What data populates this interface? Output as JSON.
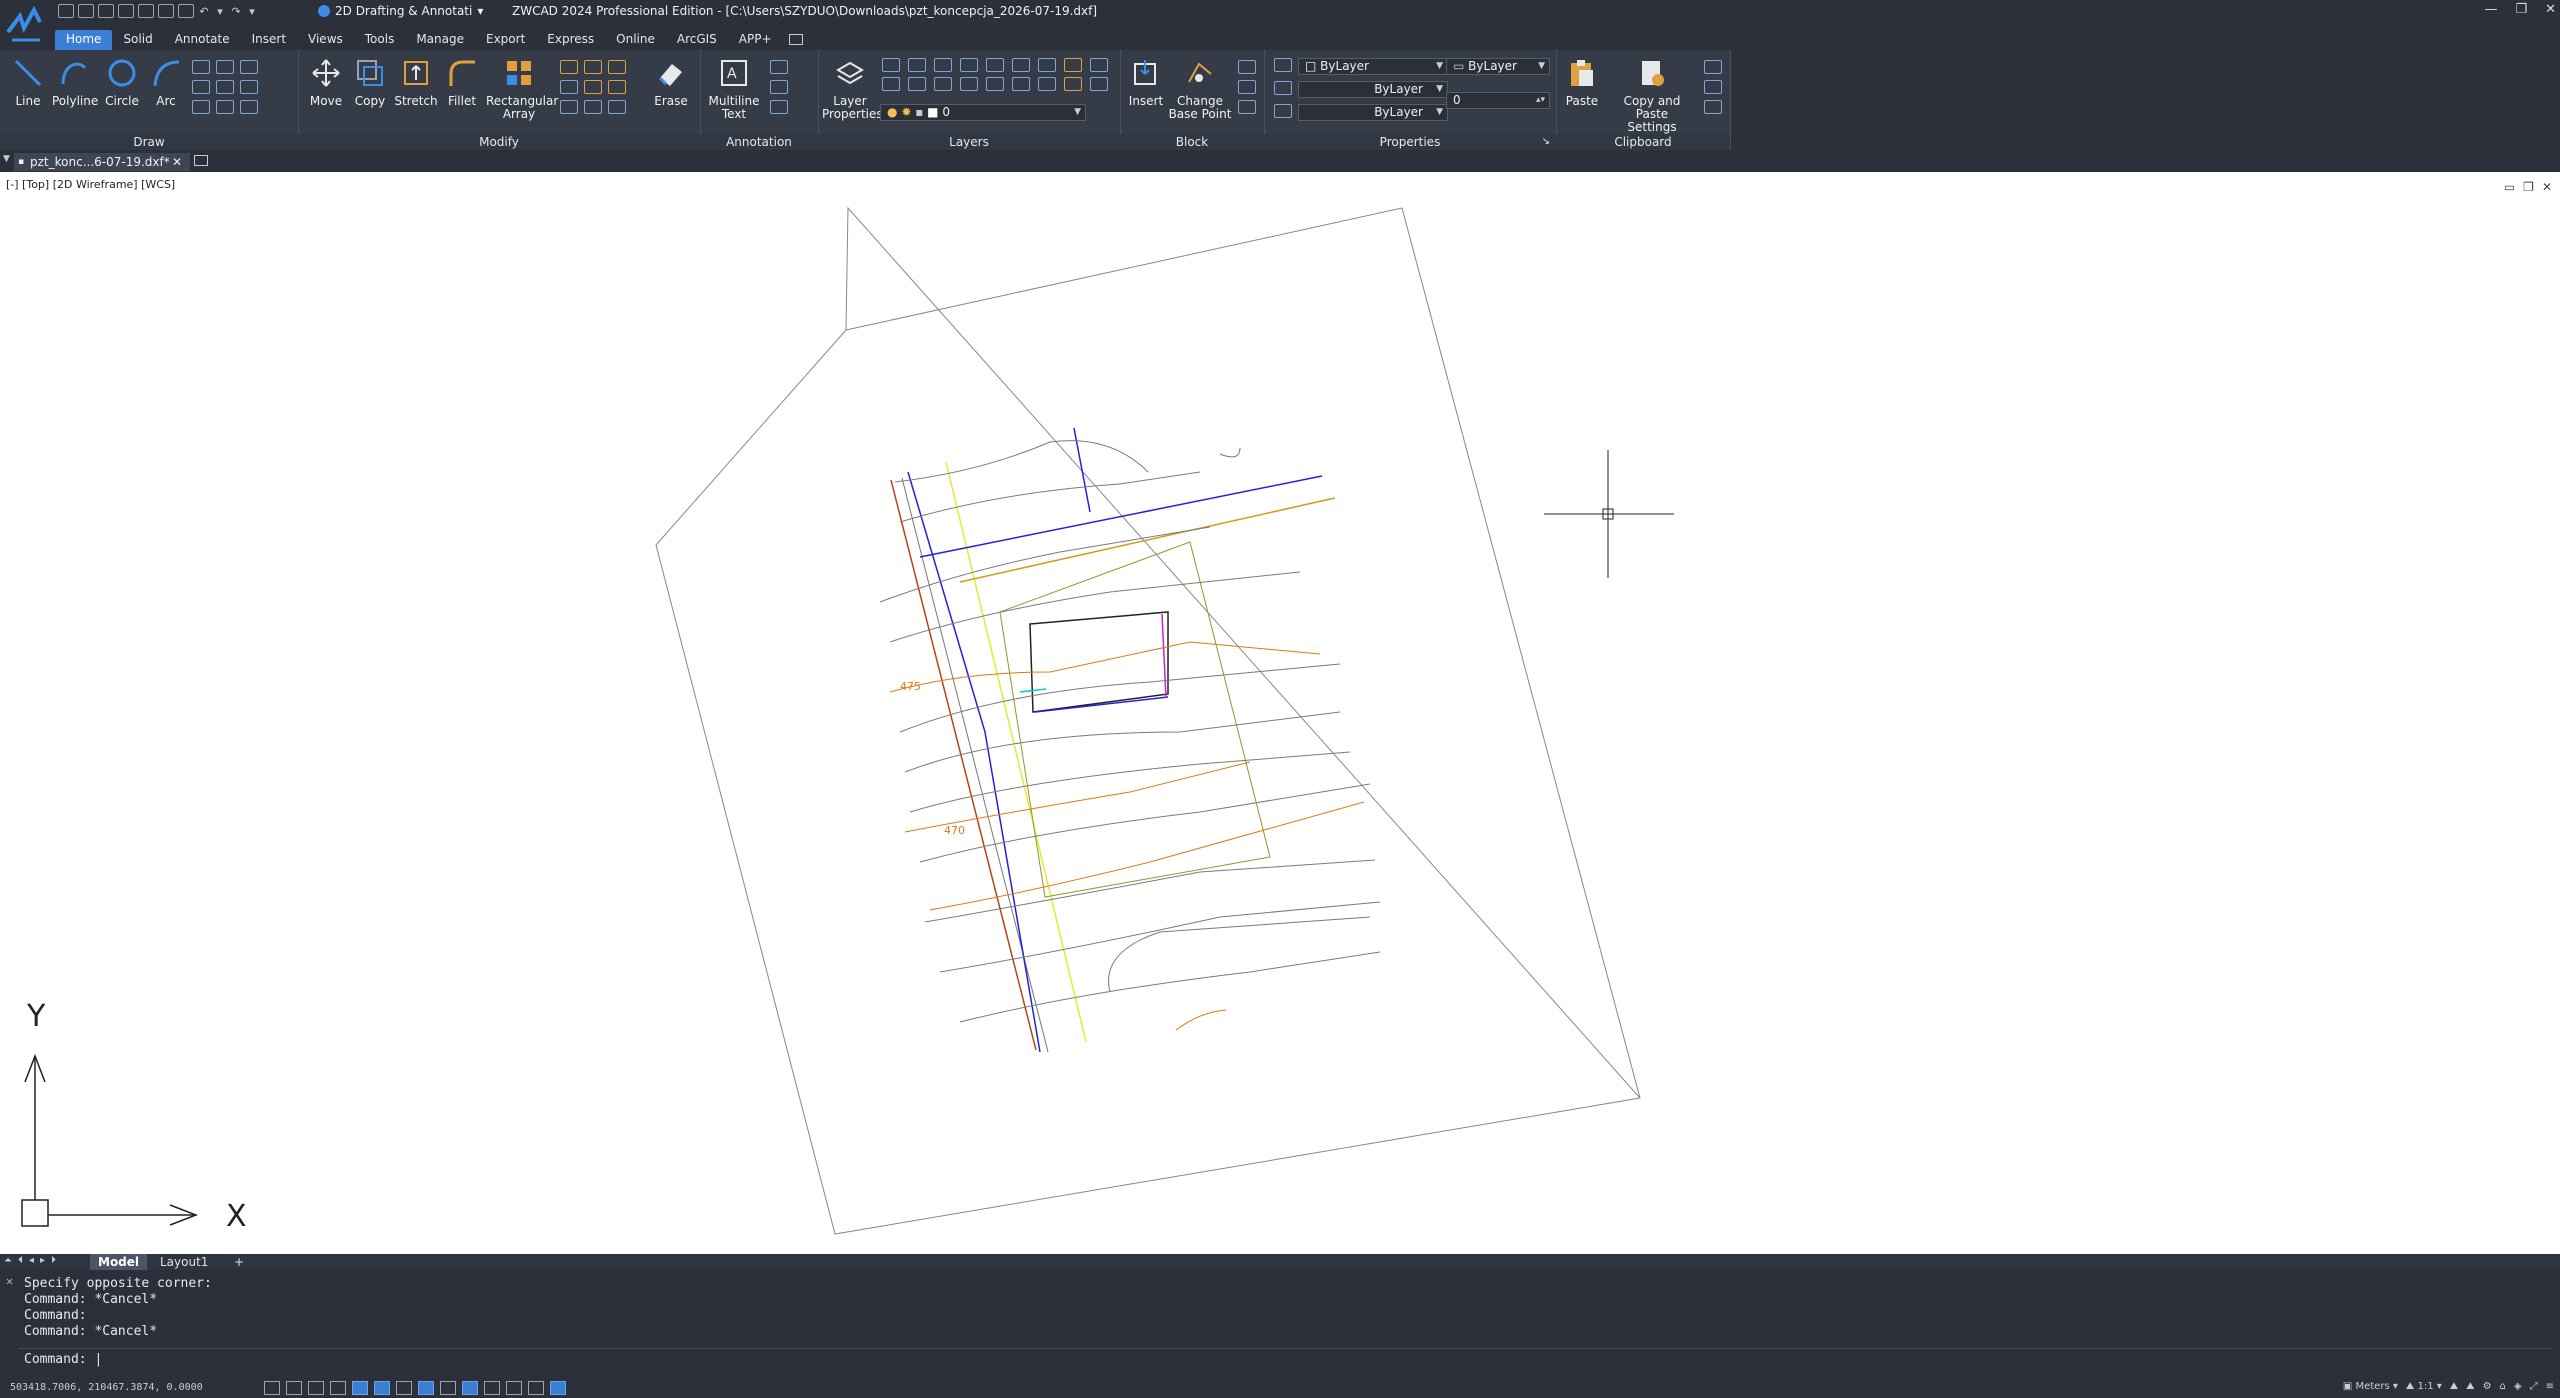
{
  "window": {
    "title": "ZWCAD 2024 Professional Edition - [C:\\Users\\SZYDUO\\Downloads\\pzt_koncepcja_2026-07-19.dxf]",
    "workspace": "2D Drafting & Annotati",
    "controls": [
      "—",
      "❐",
      "✕"
    ]
  },
  "ribbon_tabs": [
    "Home",
    "Solid",
    "Annotate",
    "Insert",
    "Views",
    "Tools",
    "Manage",
    "Export",
    "Express",
    "Online",
    "ArcGIS",
    "APP+"
  ],
  "panels": {
    "draw": {
      "label": "Draw",
      "buttons": [
        "Line",
        "Polyline",
        "Circle",
        "Arc"
      ]
    },
    "modify": {
      "label": "Modify",
      "buttons": [
        "Move",
        "Copy",
        "Stretch",
        "Fillet",
        "Rectangular\nArray",
        "Erase"
      ]
    },
    "annotation": {
      "label": "Annotation",
      "button": "Multiline\nText"
    },
    "layers": {
      "label": "Layers",
      "button": "Layer\nProperties",
      "current_layer": "0"
    },
    "block": {
      "label": "Block",
      "buttons": [
        "Insert",
        "Change\nBase Point"
      ]
    },
    "properties": {
      "label": "Properties",
      "color": "ByLayer",
      "linetype": "ByLayer",
      "lineweight": "ByLayer",
      "plotstyle": "ByLayer",
      "transparency": "0"
    },
    "clipboard": {
      "label": "Clipboard",
      "buttons": [
        "Paste",
        "Copy and Paste\nSettings"
      ]
    }
  },
  "document_tab": "pzt_konc...6-07-19.dxf*",
  "viewport_label": "[-] [Top] [2D Wireframe] [WCS]",
  "drawing": {
    "contour_labels": [
      "475",
      "470"
    ],
    "ucs": {
      "x": "X",
      "y": "Y"
    }
  },
  "layout_tabs": [
    "Model",
    "Layout1",
    "+"
  ],
  "command_history": [
    "Specify opposite corner:",
    "Command: *Cancel*",
    "Command:",
    "Command: *Cancel*"
  ],
  "command_prompt": "Command:",
  "status": {
    "coordinates": "503418.7006, 210467.3874, 0.0000",
    "units": "Meters",
    "scale": "1:1"
  }
}
